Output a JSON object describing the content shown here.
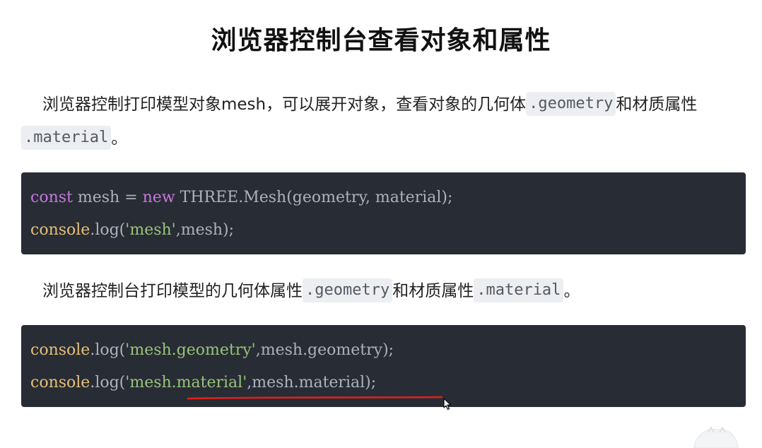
{
  "title": "浏览器控制台查看对象和属性",
  "para1": {
    "text_before": "浏览器控制打印模型对象mesh，可以展开对象，查看对象的几何体",
    "code1": ".geometry",
    "text_middle": "和材质属性",
    "code2": ".material",
    "text_after": "。"
  },
  "code_block_1": {
    "line1": {
      "kw": "const",
      "rest1": " mesh = ",
      "kw2": "new",
      "rest2": " THREE.Mesh(geometry, material);"
    },
    "line2": {
      "obj": "console",
      "rest1": ".log(",
      "str": "'mesh'",
      "rest2": ",mesh);"
    }
  },
  "para2": {
    "text_before": "浏览器控制台打印模型的几何体属性",
    "code1": ".geometry",
    "text_middle": "和材质属性",
    "code2": ".material",
    "text_after": "。"
  },
  "code_block_2": {
    "line1": {
      "obj": "console",
      "rest1": ".log(",
      "str": "'mesh.geometry'",
      "rest2": ",mesh.geometry);"
    },
    "line2": {
      "obj": "console",
      "rest1": ".log(",
      "str": "'mesh.material'",
      "rest2": ",mesh.material);"
    }
  },
  "colors": {
    "code_bg": "#282c34",
    "keyword": "#c678dd",
    "object": "#e5c07b",
    "string": "#98c379",
    "underline": "#e0201a"
  }
}
